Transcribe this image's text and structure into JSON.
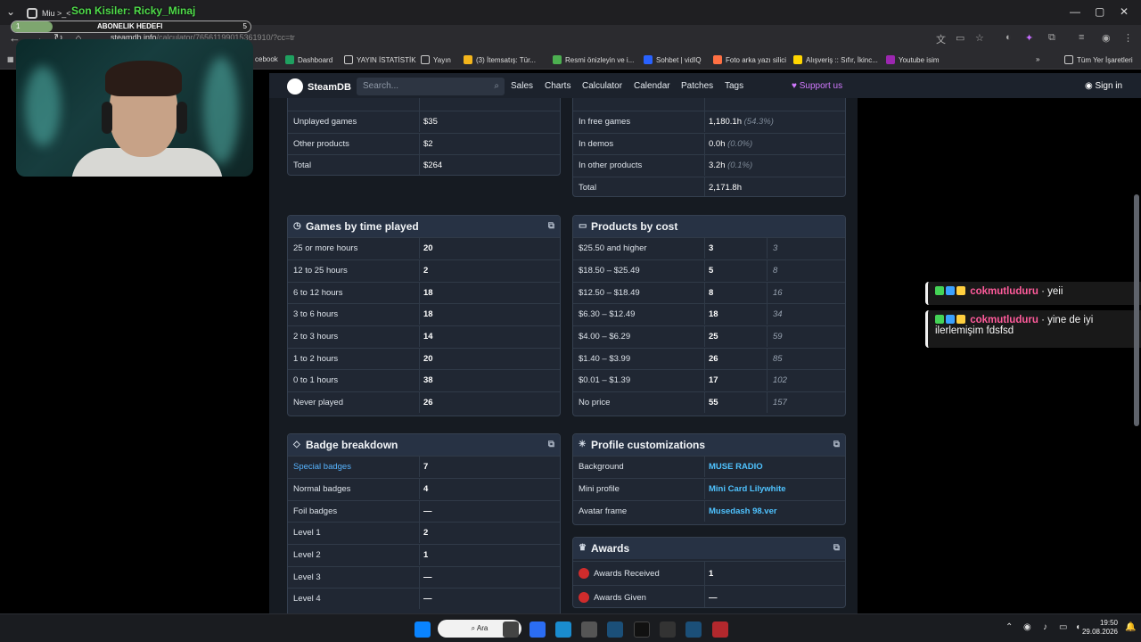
{
  "browser": {
    "tab_title": "Miu >_<",
    "url_prefix": "steamdb.info",
    "url_path": "/calculator/76561199015361910/?cc=tr"
  },
  "overlay": {
    "stream_title": "Son Kisiler: Ricky_Minaj",
    "sub_goal_label": "ABONELIK HEDEFI",
    "sub_goal_current": "1",
    "sub_goal_target": "5"
  },
  "bookmarks": [
    {
      "label": "cebook"
    },
    {
      "label": "Dashboard"
    },
    {
      "label": "YAYIN İSTATİSTİK"
    },
    {
      "label": "Yayın"
    },
    {
      "label": "(3) İtemsatış: Tür..."
    },
    {
      "label": "Resmi önizleyin ve i..."
    },
    {
      "label": "Sohbet | vidIQ"
    },
    {
      "label": "Foto arka yazı silici"
    },
    {
      "label": "Alışveriş :: Sıfır, İkinc..."
    },
    {
      "label": "Youtube isim"
    },
    {
      "label": "Tüm Yer İşaretleri"
    }
  ],
  "steamdb": {
    "logo": "SteamDB",
    "search_placeholder": "Search...",
    "nav": [
      "Sales",
      "Charts",
      "Calculator",
      "Calendar",
      "Patches",
      "Tags"
    ],
    "support": "Support us",
    "signin": "Sign in"
  },
  "cost_table_partial": {
    "rows": [
      {
        "label": "Unplayed games",
        "value": "$35"
      },
      {
        "label": "Other products",
        "value": "$2"
      },
      {
        "label": "Total",
        "value": "$264"
      }
    ]
  },
  "hours_table_partial": {
    "rows": [
      {
        "label": "In free games",
        "value": "1,180.1h",
        "pct": "(54.3%)"
      },
      {
        "label": "In demos",
        "value": "0.0h",
        "pct": "(0.0%)"
      },
      {
        "label": "In other products",
        "value": "3.2h",
        "pct": "(0.1%)"
      },
      {
        "label": "Total",
        "value": "2,171.8h",
        "pct": ""
      }
    ]
  },
  "games_by_time": {
    "title": "Games by time played",
    "rows": [
      {
        "label": "25 or more hours",
        "value": "20"
      },
      {
        "label": "12 to 25 hours",
        "value": "2"
      },
      {
        "label": "6 to 12 hours",
        "value": "18"
      },
      {
        "label": "3 to 6 hours",
        "value": "18"
      },
      {
        "label": "2 to 3 hours",
        "value": "14"
      },
      {
        "label": "1 to 2 hours",
        "value": "20"
      },
      {
        "label": "0 to 1 hours",
        "value": "38"
      },
      {
        "label": "Never played",
        "value": "26"
      }
    ]
  },
  "products_by_cost": {
    "title": "Products by cost",
    "rows": [
      {
        "label": "$25.50 and higher",
        "value": "3",
        "cum": "3"
      },
      {
        "label": "$18.50 – $25.49",
        "value": "5",
        "cum": "8"
      },
      {
        "label": "$12.50 – $18.49",
        "value": "8",
        "cum": "16"
      },
      {
        "label": "$6.30 – $12.49",
        "value": "18",
        "cum": "34"
      },
      {
        "label": "$4.00 – $6.29",
        "value": "25",
        "cum": "59"
      },
      {
        "label": "$1.40 – $3.99",
        "value": "26",
        "cum": "85"
      },
      {
        "label": "$0.01 – $1.39",
        "value": "17",
        "cum": "102"
      },
      {
        "label": "No price",
        "value": "55",
        "cum": "157"
      }
    ]
  },
  "badge_breakdown": {
    "title": "Badge breakdown",
    "rows": [
      {
        "label": "Special badges",
        "value": "7"
      },
      {
        "label": "Normal badges",
        "value": "4"
      },
      {
        "label": "Foil badges",
        "value": "—"
      },
      {
        "label": "Level 1",
        "value": "2"
      },
      {
        "label": "Level 2",
        "value": "1"
      },
      {
        "label": "Level 3",
        "value": "—"
      },
      {
        "label": "Level 4",
        "value": "—"
      }
    ]
  },
  "profile_customizations": {
    "title": "Profile customizations",
    "rows": [
      {
        "label": "Background",
        "value": "MUSE RADIO"
      },
      {
        "label": "Mini profile",
        "value": "Mini Card Lilywhite"
      },
      {
        "label": "Avatar frame",
        "value": "Musedash 98.ver"
      }
    ]
  },
  "awards": {
    "title": "Awards",
    "rows": [
      {
        "label": "Awards Received",
        "value": "1"
      },
      {
        "label": "Awards Given",
        "value": "—"
      }
    ]
  },
  "chat": [
    {
      "user": "cokmutluduru",
      "sep": "·",
      "message": "yeii"
    },
    {
      "user": "cokmutluduru",
      "sep": "·",
      "message": "yine de iyi ilerlemişim fdsfsd"
    }
  ],
  "taskbar": {
    "search_label": "Ara",
    "time": "19:50",
    "date": "29.08.2026"
  },
  "colors": {
    "accent_link": "#57b4ff",
    "support": "#d27aff",
    "chat_name": "#ff5b9b",
    "overlay_title": "#4fdc4a"
  }
}
